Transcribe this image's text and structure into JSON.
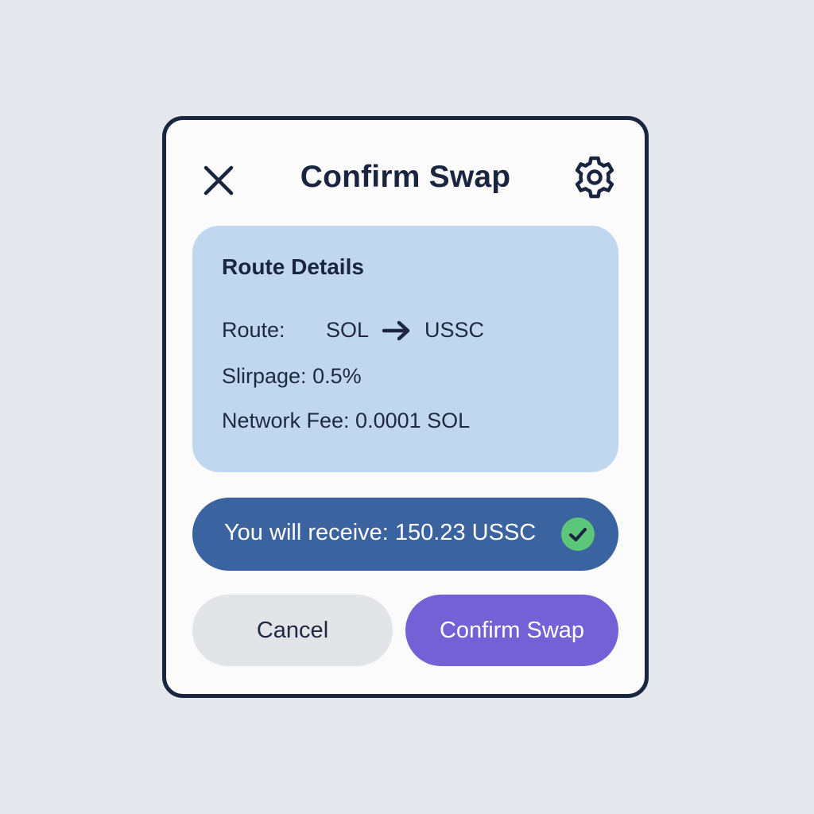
{
  "header": {
    "title": "Confirm Swap",
    "close_icon": "close-icon",
    "settings_icon": "gear-icon"
  },
  "route_details": {
    "heading": "Route Details",
    "route_label": "Route:",
    "route_from": "SOL",
    "route_arrow_icon": "arrow-right-icon",
    "route_to": "USSC",
    "slippage": "Slirpage: 0.5%",
    "network_fee": "Network Fee: 0.0001 SOL"
  },
  "receive": {
    "text": "You will receive: 150.23 USSC",
    "status_icon": "check-circle-icon"
  },
  "actions": {
    "cancel_label": "Cancel",
    "confirm_label": "Confirm Swap"
  },
  "colors": {
    "background": "#e4e7eb",
    "modal_border": "#1a2640",
    "route_card": "#c0d7ef",
    "receive_bar": "#3b63a0",
    "check_green": "#5cc77a",
    "cancel_button": "#e2e4e8",
    "confirm_button": "#7461d6"
  }
}
